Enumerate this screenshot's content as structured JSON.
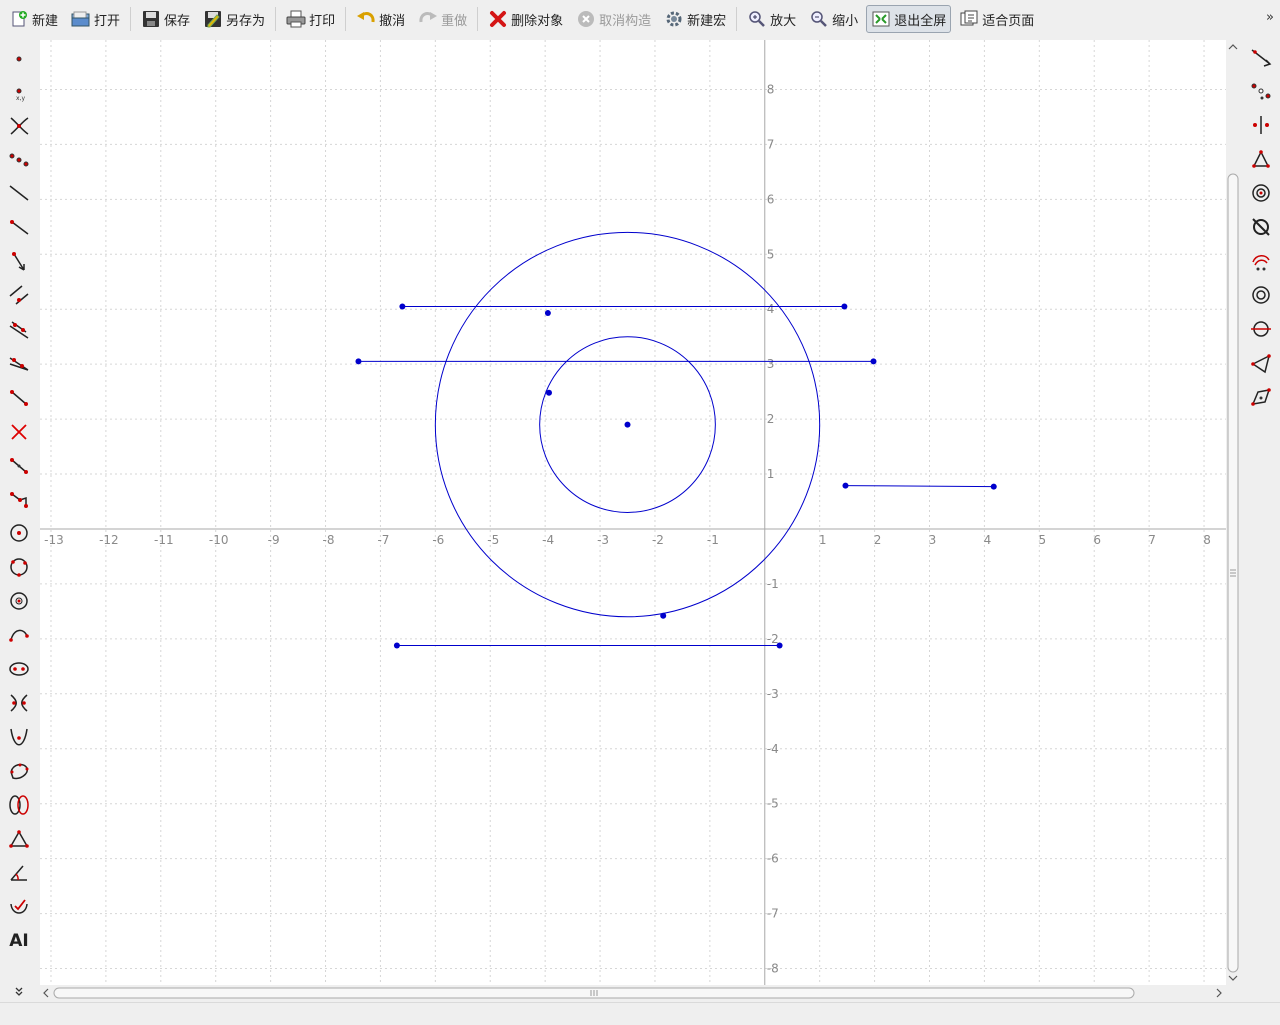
{
  "toolbar": {
    "items": [
      {
        "id": "new",
        "label": "新建",
        "icon": "new-file-icon",
        "enabled": true
      },
      {
        "id": "open",
        "label": "打开",
        "icon": "open-folder-icon",
        "enabled": true
      },
      {
        "id": "save",
        "label": "保存",
        "icon": "floppy-disk-icon",
        "enabled": true
      },
      {
        "id": "save_as",
        "label": "另存为",
        "icon": "save-as-pencil-icon",
        "enabled": true
      },
      {
        "id": "print",
        "label": "打印",
        "icon": "printer-icon",
        "enabled": true
      },
      {
        "id": "undo",
        "label": "撤消",
        "icon": "undo-arrow-icon",
        "enabled": true
      },
      {
        "id": "redo",
        "label": "重做",
        "icon": "redo-arrow-icon",
        "enabled": false
      },
      {
        "id": "delete",
        "label": "删除对象",
        "icon": "red-x-icon",
        "enabled": true
      },
      {
        "id": "cancel_construct",
        "label": "取消构造",
        "icon": "cancel-circle-icon",
        "enabled": false
      },
      {
        "id": "new_macro",
        "label": "新建宏",
        "icon": "gear-icon",
        "enabled": true
      },
      {
        "id": "zoom_in",
        "label": "放大",
        "icon": "zoom-in-icon",
        "enabled": true
      },
      {
        "id": "zoom_out",
        "label": "缩小",
        "icon": "zoom-out-icon",
        "enabled": true
      },
      {
        "id": "exit_fullscreen",
        "label": "退出全屏",
        "icon": "exit-fullscreen-icon",
        "enabled": true,
        "active": true
      },
      {
        "id": "fit_page",
        "label": "适合页面",
        "icon": "fit-page-icon",
        "enabled": true
      }
    ],
    "more": "»"
  },
  "left_tools": [
    "point-icon",
    "point-by-coords-icon",
    "intersection-point-icon",
    "midpoint-icon",
    "line-icon",
    "ray-icon",
    "vector-icon",
    "parallel-line-icon",
    "perpendicular-line-icon",
    "angle-bisector-icon",
    "segment-icon",
    "segment-delete-icon",
    "polyline-icon",
    "polygon-icon",
    "circle-center-point-icon",
    "circle-three-points-icon",
    "circle-center-radius-icon",
    "arc-icon",
    "ellipse-icon",
    "hyperbola-icon",
    "parabola-icon",
    "conic-icon",
    "bezier-icon",
    "triangle-icon",
    "angle-icon",
    "locus-icon",
    "text-label-icon",
    "more-tools-chevron-icon"
  ],
  "left_tool_text": "AI",
  "right_tools": [
    "reflect-line-icon",
    "reflect-point-icon",
    "mirror-axis-icon",
    "rotate-icon",
    "spiral-icon",
    "crossed-circle-icon",
    "dilate-icon",
    "circle-dot-icon",
    "circle-line-icon",
    "translate-icon",
    "homothety-icon"
  ],
  "canvas": {
    "x_ticks": [
      -13,
      -12,
      -11,
      -10,
      -9,
      -8,
      -7,
      -6,
      -5,
      -4,
      -3,
      -2,
      -1,
      1,
      2,
      3,
      4,
      5,
      6,
      7,
      8
    ],
    "y_ticks": [
      8,
      7,
      6,
      5,
      4,
      3,
      2,
      1,
      -1,
      -2,
      -3,
      -4,
      -5,
      -6,
      -7,
      -8
    ],
    "x_range": [
      -13.2,
      8.4
    ],
    "y_range": [
      8.9,
      -8.3
    ],
    "object_color": "#0000cc",
    "circles": [
      {
        "cx": -2.5,
        "cy": 1.9,
        "r": 3.5
      },
      {
        "cx": -2.5,
        "cy": 1.9,
        "r": 1.6
      }
    ],
    "segments": [
      {
        "x1": -6.6,
        "y1": 4.05,
        "x2": 1.45,
        "y2": 4.05
      },
      {
        "x1": -7.4,
        "y1": 3.05,
        "x2": 1.98,
        "y2": 3.05
      },
      {
        "x1": 1.47,
        "y1": 0.79,
        "x2": 4.17,
        "y2": 0.77
      },
      {
        "x1": -6.7,
        "y1": -2.12,
        "x2": 0.27,
        "y2": -2.12
      }
    ],
    "points": [
      {
        "x": -2.5,
        "y": 1.9
      },
      {
        "x": -3.95,
        "y": 3.93
      },
      {
        "x": -3.93,
        "y": 2.48
      },
      {
        "x": -1.85,
        "y": -1.58
      }
    ]
  }
}
